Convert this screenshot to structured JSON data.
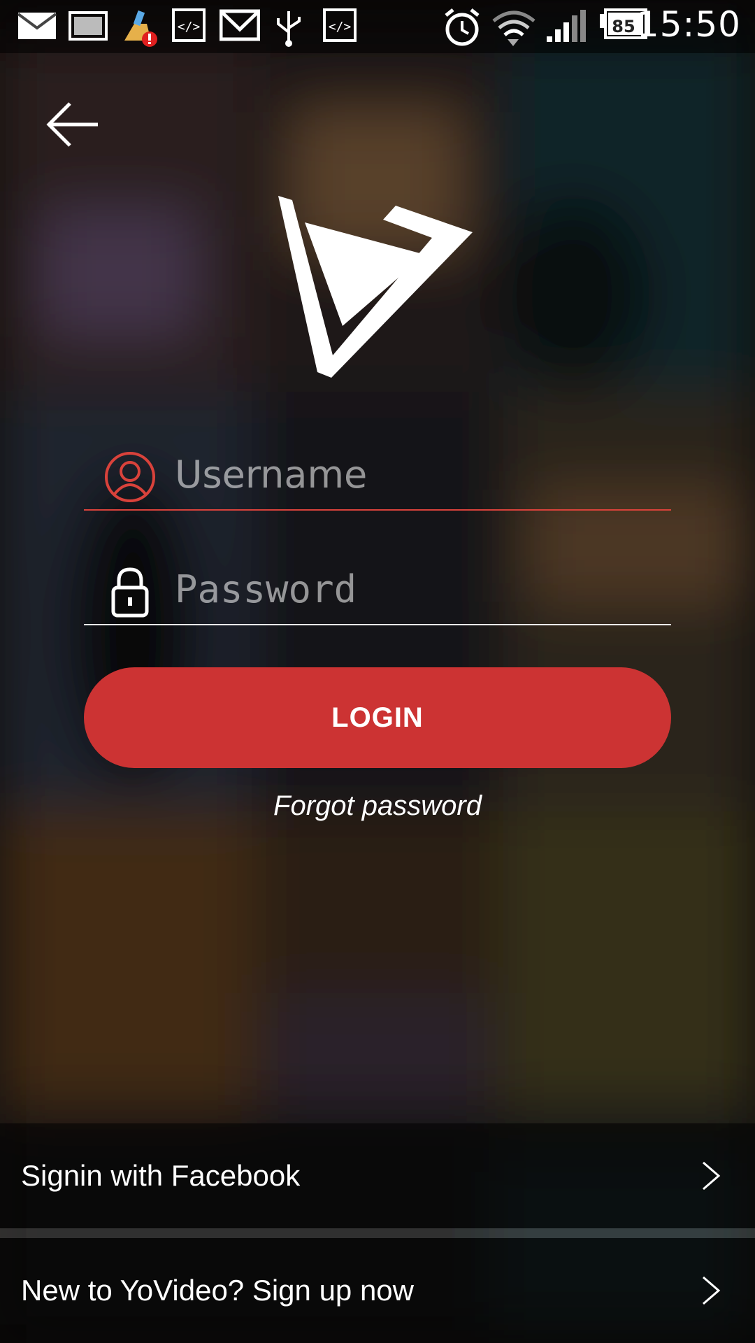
{
  "status_bar": {
    "time": "15:50",
    "battery_level": "85",
    "icons": [
      "mail-icon",
      "gallery-icon",
      "cleaner-alert-icon",
      "code-icon",
      "gmail-icon",
      "usb-icon",
      "code-icon",
      "alarm-icon",
      "wifi-icon",
      "signal-icon",
      "battery-icon"
    ]
  },
  "header": {
    "back_icon": "arrow-left-icon"
  },
  "logo": {
    "icon": "yovideo-logo"
  },
  "form": {
    "username_placeholder": "Username",
    "username_value": "",
    "password_placeholder": "Password",
    "password_value": "",
    "login_label": "LOGIN",
    "forgot_label": "Forgot password"
  },
  "bottom": {
    "facebook_label": "Signin with Facebook",
    "signup_label": "New to YoVideo? Sign up now"
  },
  "colors": {
    "accent": "#cc3333",
    "username_underline": "#d9423b",
    "password_underline": "#ffffff",
    "user_icon": "#d9423b"
  }
}
